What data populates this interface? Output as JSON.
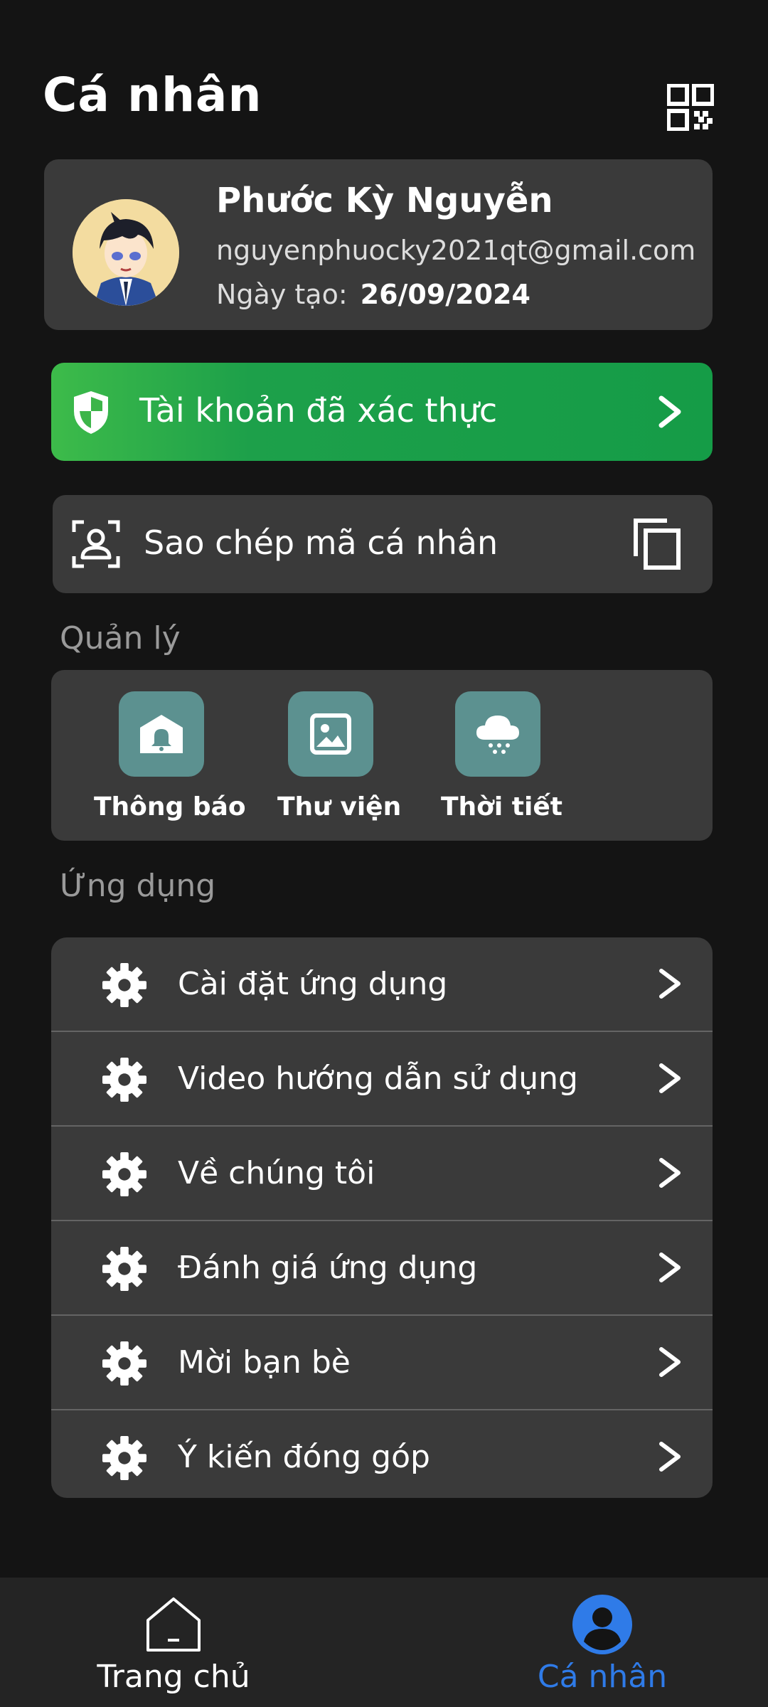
{
  "page_title": "Cá nhân",
  "profile": {
    "name": "Phước Kỳ Nguyễn",
    "email": "nguyenphuocky2021qt@gmail.com",
    "created_label": "Ngày tạo:",
    "created_date": "26/09/2024"
  },
  "verified": {
    "label": "Tài khoản đã xác thực",
    "color": "#1da04a"
  },
  "copy_code": {
    "label": "Sao chép mã cá nhân"
  },
  "manage": {
    "title": "Quản lý",
    "tiles": [
      {
        "label": "Thông báo",
        "icon": "bell-icon"
      },
      {
        "label": "Thư viện",
        "icon": "image-icon"
      },
      {
        "label": "Thời tiết",
        "icon": "cloud-snow-icon"
      }
    ]
  },
  "apps": {
    "title": "Ứng dụng",
    "items": [
      {
        "label": "Cài đặt ứng dụng",
        "icon": "gear-icon"
      },
      {
        "label": "Video hướng dẫn sử dụng",
        "icon": "gear-icon"
      },
      {
        "label": "Về chúng tôi",
        "icon": "gear-icon"
      },
      {
        "label": "Đánh giá ứng dụng",
        "icon": "gear-icon"
      },
      {
        "label": "Mời bạn bè",
        "icon": "gear-icon"
      },
      {
        "label": "Ý kiến đóng góp",
        "icon": "gear-icon"
      }
    ]
  },
  "nav": {
    "home": "Trang chủ",
    "profile": "Cá nhân",
    "active_color": "#2f7be8"
  }
}
